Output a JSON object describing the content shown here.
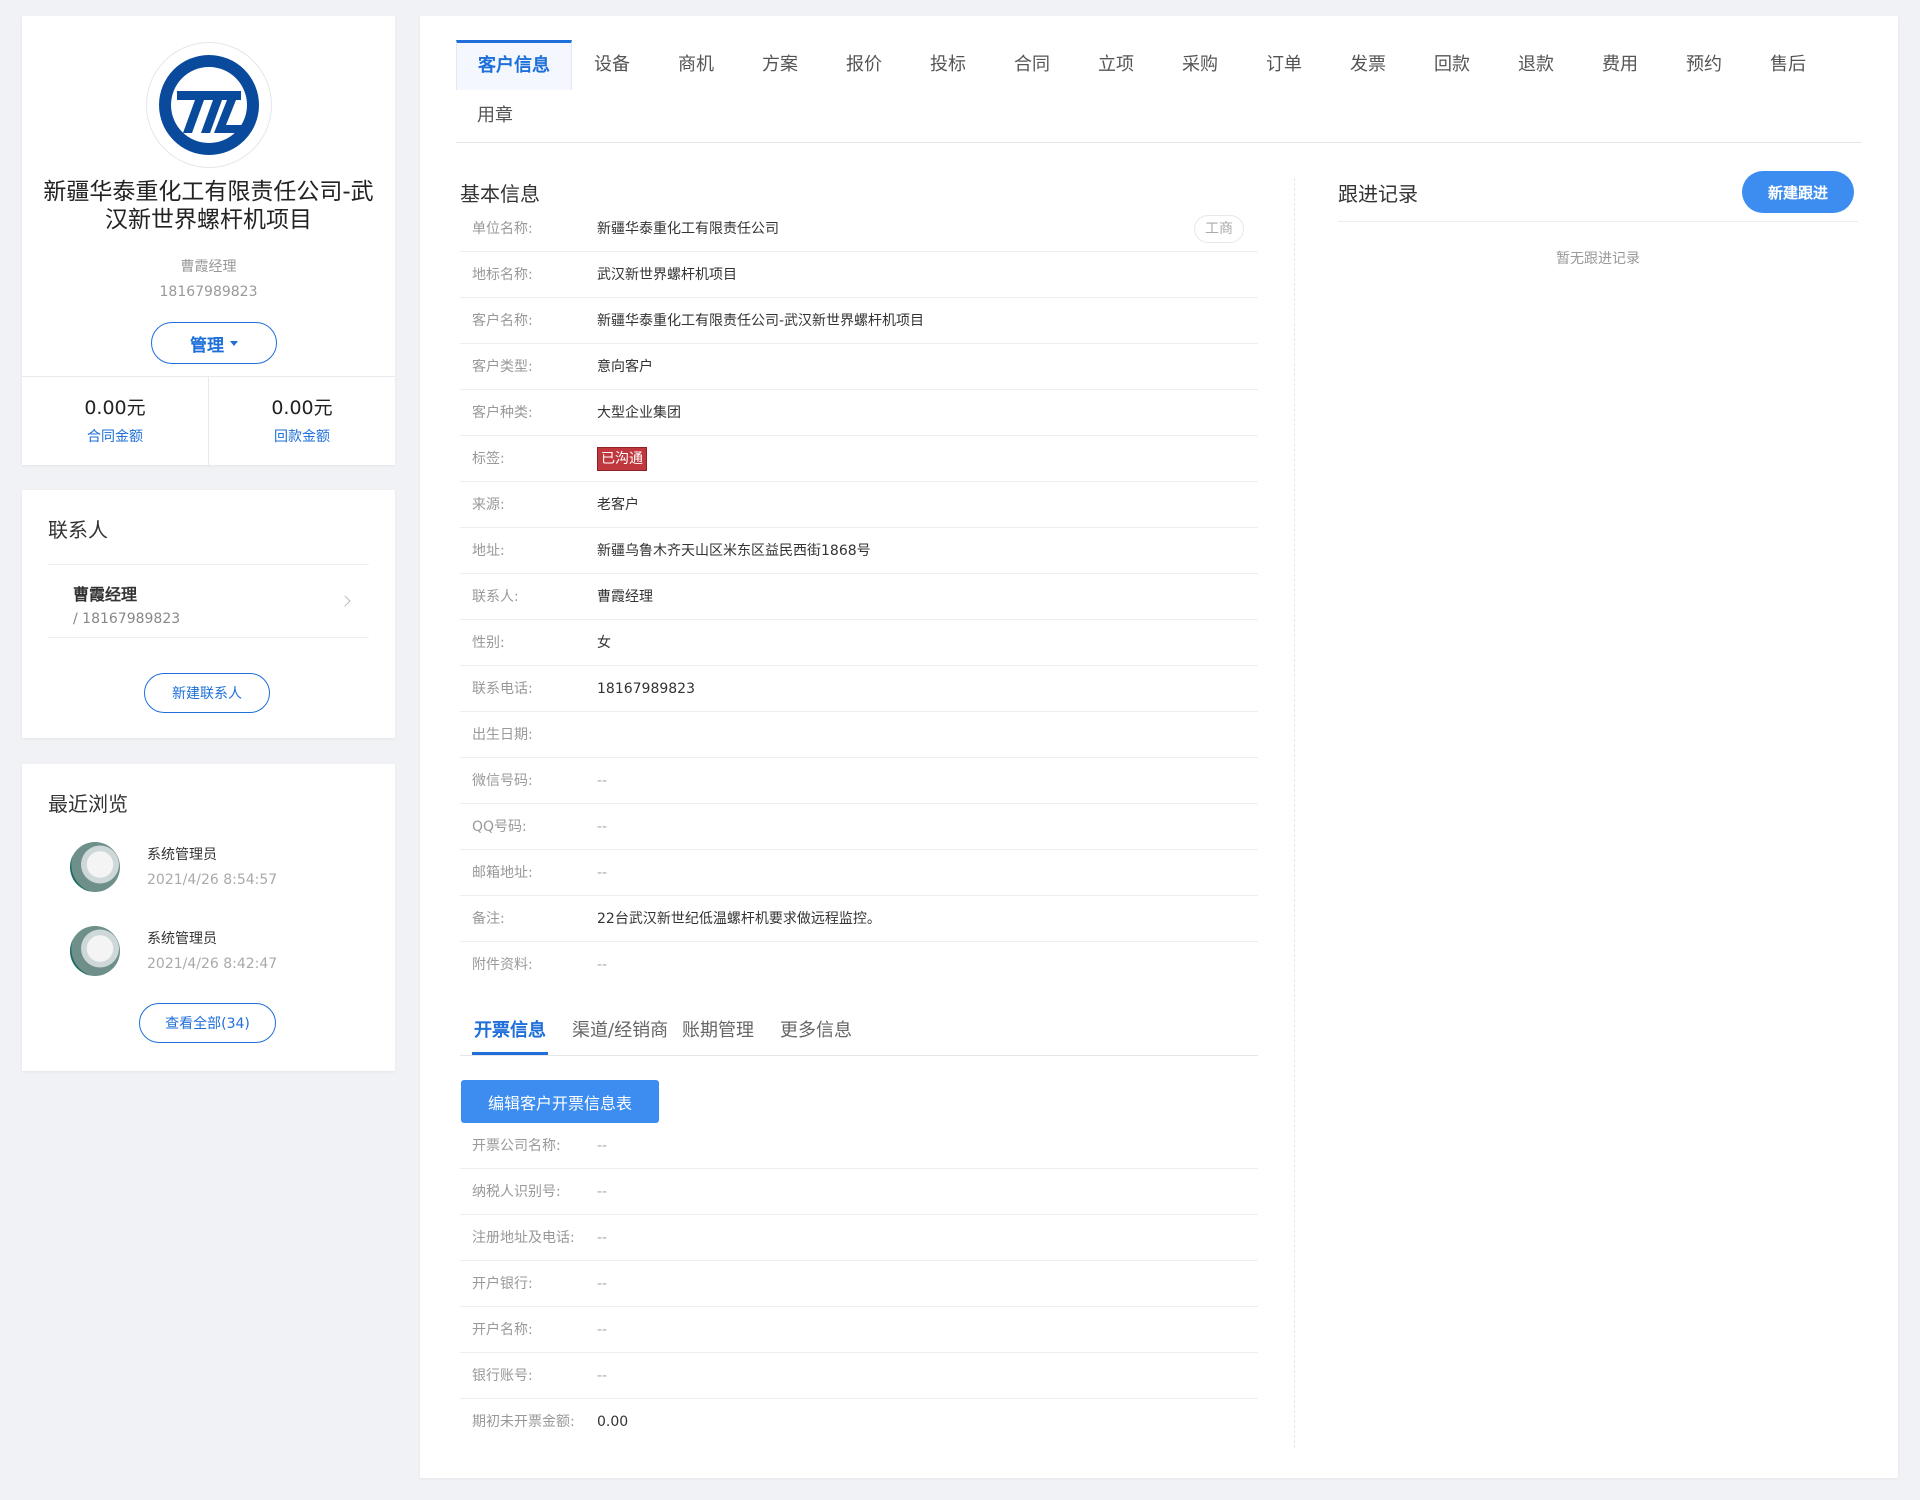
{
  "profile": {
    "company_name": "新疆华泰重化工有限责任公司-武汉新世界螺杆机项目",
    "contact_name": "曹霞经理",
    "phone": "18167989823",
    "manage_label": "管理",
    "stats": [
      {
        "value": "0.00元",
        "label": "合同金额"
      },
      {
        "value": "0.00元",
        "label": "回款金额"
      }
    ]
  },
  "contacts": {
    "title": "联系人",
    "items": [
      {
        "name": "曹霞经理",
        "phone": "/ 18167989823"
      }
    ],
    "new_button": "新建联系人"
  },
  "recent": {
    "title": "最近浏览",
    "items": [
      {
        "name": "系统管理员",
        "time": "2021/4/26 8:54:57"
      },
      {
        "name": "系统管理员",
        "time": "2021/4/26 8:42:47"
      }
    ],
    "view_all": "查看全部(34)"
  },
  "tabs": [
    "客户信息",
    "设备",
    "商机",
    "方案",
    "报价",
    "投标",
    "合同",
    "立项",
    "采购",
    "订单",
    "发票",
    "回款",
    "退款",
    "费用",
    "预约",
    "售后",
    "用章"
  ],
  "basic_info": {
    "title": "基本信息",
    "gs_tag": "工商",
    "rows": [
      {
        "label": "单位名称:",
        "value": "新疆华泰重化工有限责任公司"
      },
      {
        "label": "地标名称:",
        "value": "武汉新世界螺杆机项目"
      },
      {
        "label": "客户名称:",
        "value": "新疆华泰重化工有限责任公司-武汉新世界螺杆机项目"
      },
      {
        "label": "客户类型:",
        "value": "意向客户"
      },
      {
        "label": "客户种类:",
        "value": "大型企业集团"
      },
      {
        "label": "标签:",
        "value": "已沟通"
      },
      {
        "label": "来源:",
        "value": "老客户"
      },
      {
        "label": "地址:",
        "value": "新疆乌鲁木齐天山区米东区益民西街1868号"
      },
      {
        "label": "联系人:",
        "value": "曹霞经理"
      },
      {
        "label": "性别:",
        "value": "女"
      },
      {
        "label": "联系电话:",
        "value": "18167989823"
      },
      {
        "label": "出生日期:",
        "value": ""
      },
      {
        "label": "微信号码:",
        "value": "--"
      },
      {
        "label": "QQ号码:",
        "value": "--"
      },
      {
        "label": "邮箱地址:",
        "value": "--"
      },
      {
        "label": "备注:",
        "value": "22台武汉新世纪低温螺杆机要求做远程监控。"
      },
      {
        "label": "附件资料:",
        "value": "--"
      }
    ],
    "tag_color": "#c0383e"
  },
  "sub_tabs": [
    "开票信息",
    "渠道/经销商",
    "账期管理",
    "更多信息"
  ],
  "invoice": {
    "edit_button": "编辑客户开票信息表",
    "rows": [
      {
        "label": "开票公司名称:",
        "value": "--"
      },
      {
        "label": "纳税人识别号:",
        "value": "--"
      },
      {
        "label": "注册地址及电话:",
        "value": "--"
      },
      {
        "label": "开户银行:",
        "value": "--"
      },
      {
        "label": "开户名称:",
        "value": "--"
      },
      {
        "label": "银行账号:",
        "value": "--"
      },
      {
        "label": "期初未开票金额:",
        "value": "0.00"
      }
    ]
  },
  "follow": {
    "title": "跟进记录",
    "new_button": "新建跟进",
    "empty": "暂无跟进记录"
  },
  "colors": {
    "accent": "#1e6fd9",
    "button": "#3d8cf0",
    "logo": "#0a4a9c"
  }
}
